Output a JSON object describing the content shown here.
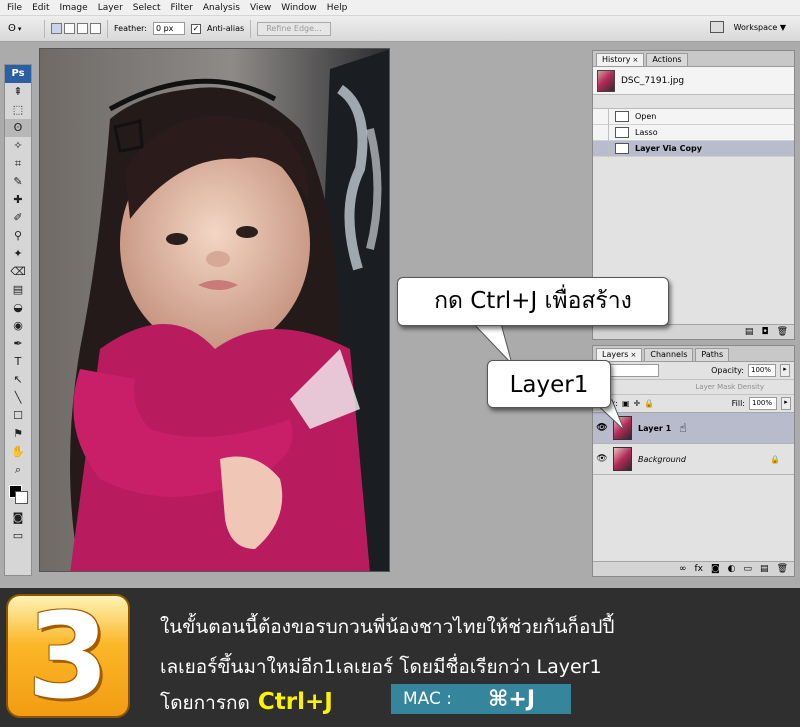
{
  "menu": [
    "File",
    "Edit",
    "Image",
    "Layer",
    "Select",
    "Filter",
    "Analysis",
    "View",
    "Window",
    "Help"
  ],
  "options": {
    "feather_label": "Feather:",
    "feather_value": "0 px",
    "antialias_label": "Anti-alias",
    "refine_label": "Refine Edge...",
    "workspace_label": "Workspace ▼"
  },
  "tools": [
    "⇞",
    "⬚",
    "ʘ",
    "✧",
    "⌗",
    "✎",
    "✚",
    "✐",
    "⚲",
    "✦",
    "⌫",
    "▤",
    "◒",
    "◉",
    "✒",
    "T",
    "↖",
    "╲",
    "☐",
    "⚑",
    "✋",
    "⌕"
  ],
  "history": {
    "tabs": [
      "History",
      "Actions"
    ],
    "snapshot": "DSC_7191.jpg",
    "steps": [
      "Open",
      "Lasso",
      "Layer Via Copy"
    ]
  },
  "layers": {
    "tabs": [
      "Layers",
      "Channels",
      "Paths"
    ],
    "opacity_label": "Opacity:",
    "opacity_value": "100%",
    "mask_density": "Layer Mask Density",
    "lock_label": "Lock:",
    "fill_label": "Fill:",
    "fill_value": "100%",
    "rows": [
      {
        "name": "Layer 1",
        "selected": true
      },
      {
        "name": "Background",
        "selected": false
      }
    ]
  },
  "callouts": {
    "main": "กด Ctrl+J เพื่อสร้าง",
    "layer": "Layer1"
  },
  "banner": {
    "step_number": "3",
    "line1": "ในขั้นตอนนี้ต้องขอรบกวนพี่น้องชาวไทยให้ช่วยกันก็อปปี้",
    "line2": "เลเยอร์ขึ้นมาใหม่อีก1เลเยอร์ โดยมีชื่อเรียกว่า Layer1",
    "line3": "โดยการกด",
    "shortcut": "Ctrl+J",
    "mac_label": "MAC :",
    "mac_shortcut": "⌘+J"
  }
}
